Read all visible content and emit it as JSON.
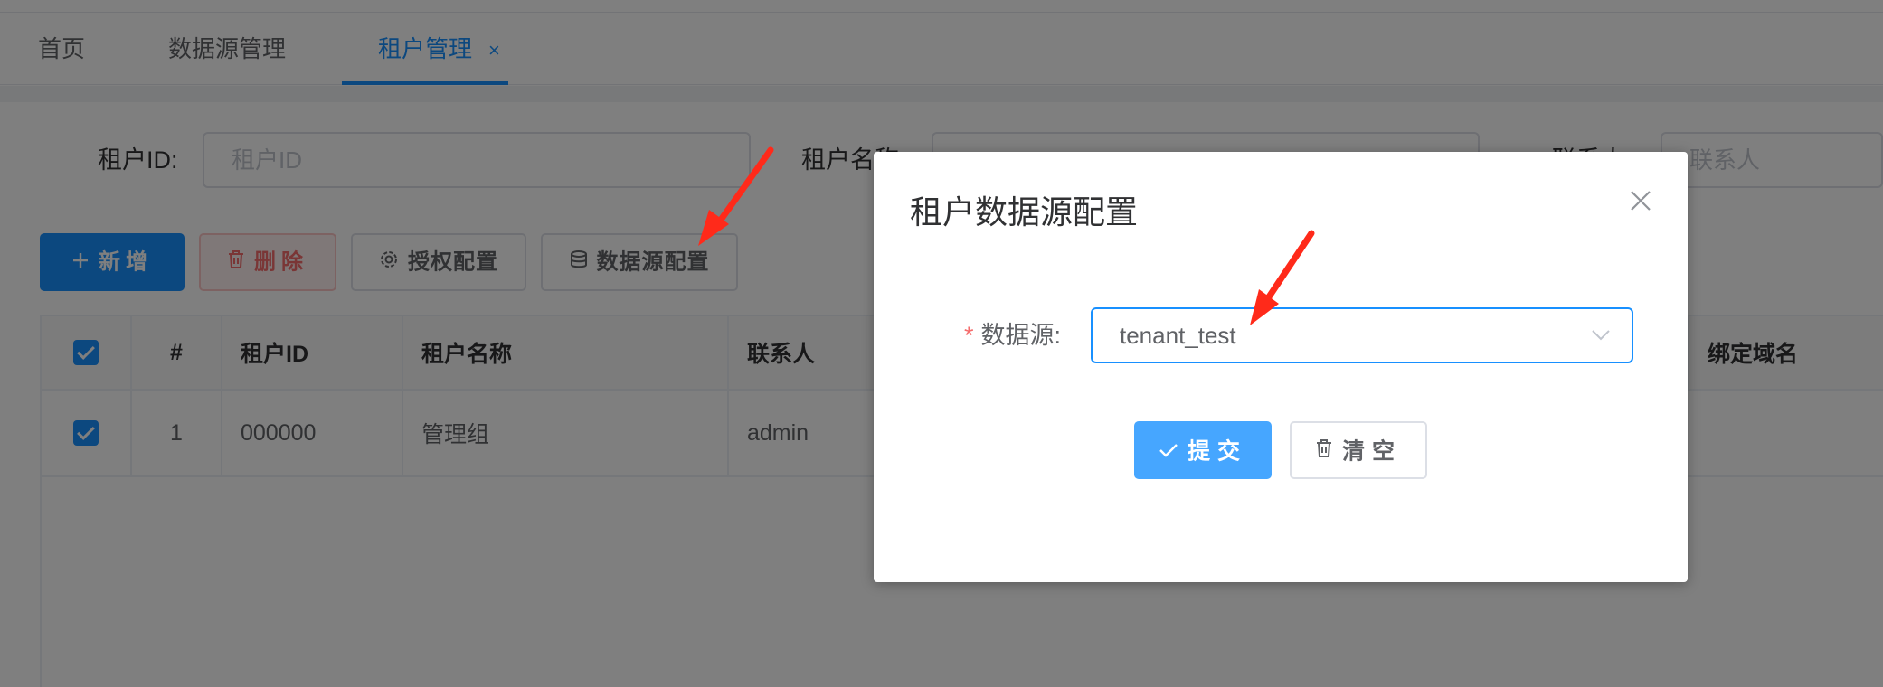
{
  "tabs": [
    {
      "label": "首页"
    },
    {
      "label": "数据源管理"
    },
    {
      "label": "租户管理",
      "close": "×"
    }
  ],
  "search": {
    "tenant_id_label": "租户ID:",
    "tenant_id_placeholder": "租户ID",
    "tenant_name_label": "租户名称",
    "contact_label": "联系人",
    "contact_placeholder": "联系人"
  },
  "toolbar": {
    "add": "新增",
    "delete": "删除",
    "auth_config": "授权配置",
    "datasource_config": "数据源配置"
  },
  "table": {
    "headers": [
      "#",
      "租户ID",
      "租户名称",
      "联系人",
      "绑定域名"
    ],
    "rows": [
      {
        "index": "1",
        "tenant_id": "000000",
        "tenant_name": "管理组",
        "contact": "admin"
      }
    ]
  },
  "dialog": {
    "title": "租户数据源配置",
    "field_label": "数据源:",
    "required_mark": "*",
    "selected_value": "tenant_test",
    "submit": "提交",
    "clear": "清空"
  },
  "colors": {
    "primary": "#1890ff",
    "danger": "#f56c6c",
    "annotation_arrow": "#ff2a1a"
  }
}
